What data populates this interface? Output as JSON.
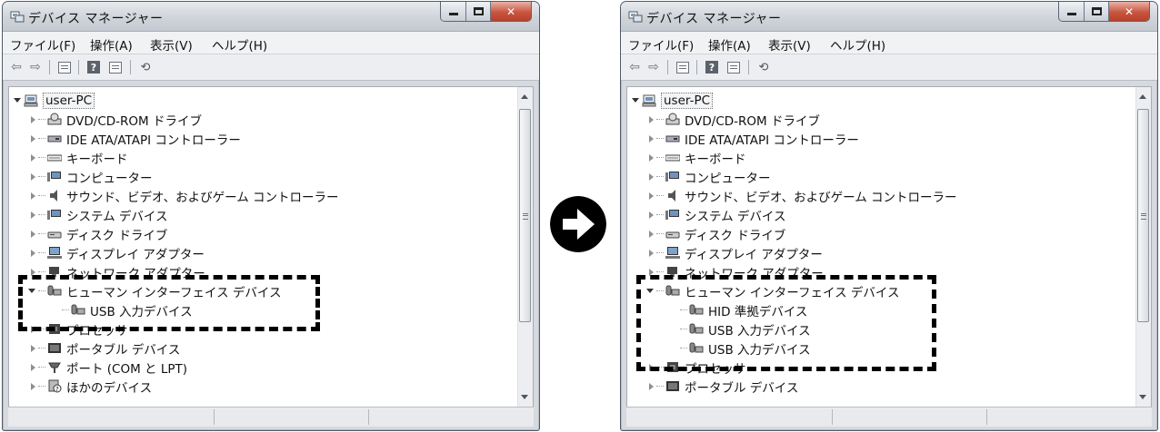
{
  "left": {
    "title": "デバイス マネージャー",
    "menu": [
      "ファイル(F)",
      "操作(A)",
      "表示(V)",
      "ヘルプ(H)"
    ],
    "root": "user-PC",
    "items": [
      "DVD/CD-ROM ドライブ",
      "IDE ATA/ATAPI コントローラー",
      "キーボード",
      "コンピューター",
      "サウンド、ビデオ、およびゲーム コントローラー",
      "システム デバイス",
      "ディスク ドライブ",
      "ディスプレイ アダプター",
      "ネットワーク アダプター",
      "ヒューマン インターフェイス デバイス",
      "USB 入力デバイス",
      "プロセッサ",
      "ポータブル デバイス",
      "ポート (COM と LPT)",
      "ほかのデバイス"
    ]
  },
  "right": {
    "title": "デバイス マネージャー",
    "menu": [
      "ファイル(F)",
      "操作(A)",
      "表示(V)",
      "ヘルプ(H)"
    ],
    "root": "user-PC",
    "items": [
      "DVD/CD-ROM ドライブ",
      "IDE ATA/ATAPI コントローラー",
      "キーボード",
      "コンピューター",
      "サウンド、ビデオ、およびゲーム コントローラー",
      "システム デバイス",
      "ディスク ドライブ",
      "ディスプレイ アダプター",
      "ネットワーク アダプター",
      "ヒューマン インターフェイス デバイス",
      "HID 準拠デバイス",
      "USB 入力デバイス",
      "USB 入力デバイス",
      "プロセッサ",
      "ポータブル デバイス"
    ]
  },
  "icons": {
    "app": "device-manager-icon",
    "back": "back-arrow-icon",
    "forward": "forward-arrow-icon",
    "transition": "right-arrow-circle-icon"
  }
}
